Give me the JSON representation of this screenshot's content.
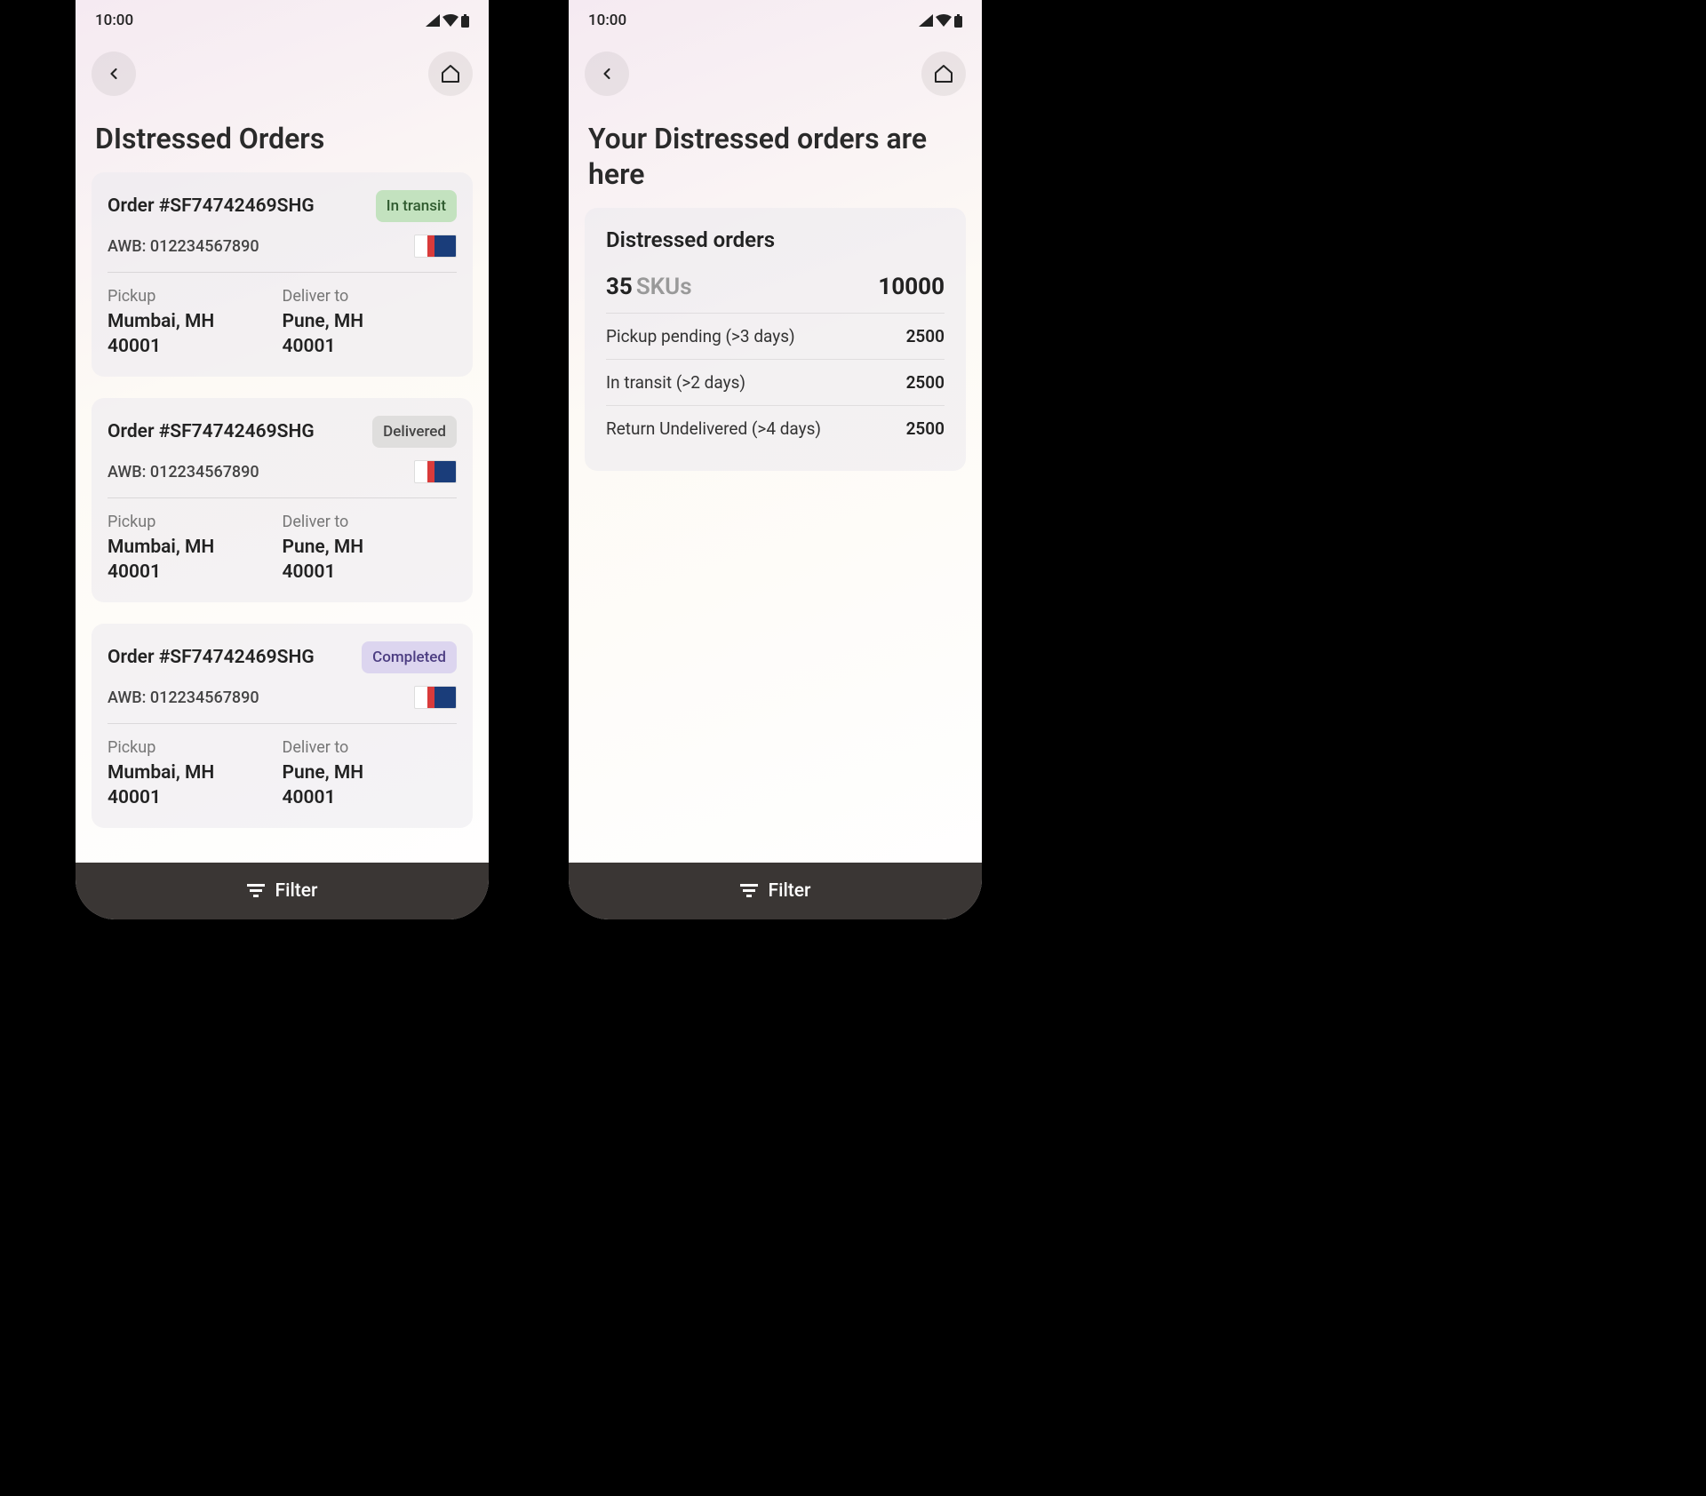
{
  "status_bar": {
    "time": "10:00"
  },
  "screen1": {
    "title": "DIstressed Orders",
    "orders": [
      {
        "id": "Order #SF74742469SHG",
        "status": "In transit",
        "status_class": "status-in-transit",
        "awb": "AWB: 012234567890",
        "pickup_label": "Pickup",
        "pickup_city": "Mumbai, MH",
        "pickup_pin": "40001",
        "deliver_label": "Deliver to",
        "deliver_city": "Pune, MH",
        "deliver_pin": "40001"
      },
      {
        "id": "Order #SF74742469SHG",
        "status": "Delivered",
        "status_class": "status-delivered",
        "awb": "AWB: 012234567890",
        "pickup_label": "Pickup",
        "pickup_city": "Mumbai, MH",
        "pickup_pin": "40001",
        "deliver_label": "Deliver to",
        "deliver_city": "Pune, MH",
        "deliver_pin": "40001"
      },
      {
        "id": "Order #SF74742469SHG",
        "status": "Completed",
        "status_class": "status-completed",
        "awb": "AWB: 012234567890",
        "pickup_label": "Pickup",
        "pickup_city": "Mumbai, MH",
        "pickup_pin": "40001",
        "deliver_label": "Deliver to",
        "deliver_city": "Pune, MH",
        "deliver_pin": "40001"
      }
    ]
  },
  "screen2": {
    "title": "Your Distressed orders are here",
    "summary": {
      "heading": "Distressed orders",
      "sku_count": "35",
      "sku_label": "SKUs",
      "total": "10000",
      "rows": [
        {
          "label": "Pickup pending (>3 days)",
          "value": "2500"
        },
        {
          "label": "In transit (>2 days)",
          "value": "2500"
        },
        {
          "label": "Return Undelivered (>4 days)",
          "value": "2500"
        }
      ]
    }
  },
  "filter_label": "Filter"
}
